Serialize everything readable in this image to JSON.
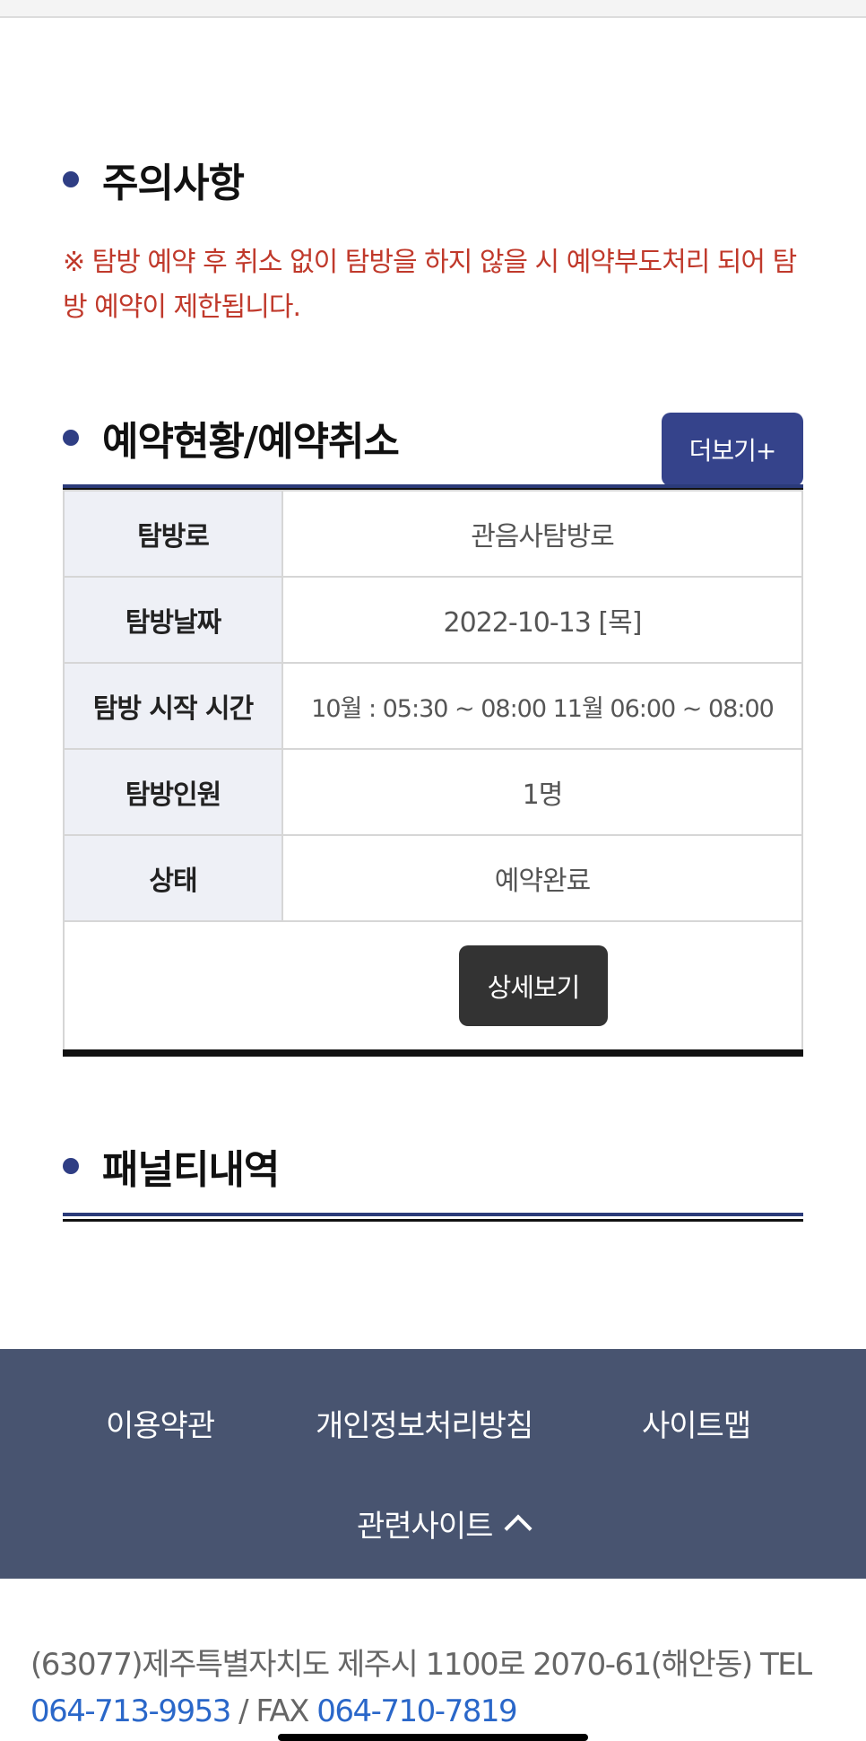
{
  "notice": {
    "title": "주의사항",
    "text": "※ 탐방 예약 후 취소 없이 탐방을 하지 않을 시 예약부도처리 되어 탐방 예약이 제한됩니다."
  },
  "reservation": {
    "title": "예약현황/예약취소",
    "more_label": "더보기+",
    "rows": [
      {
        "label": "탐방로",
        "value": "관음사탐방로"
      },
      {
        "label": "탐방날짜",
        "value": "2022-10-13 [목]"
      },
      {
        "label": "탐방 시작 시간",
        "value": "10월 : 05:30 ~ 08:00 11월 06:00 ~ 08:00"
      },
      {
        "label": "탐방인원",
        "value": "1명"
      },
      {
        "label": "상태",
        "value": "예약완료"
      }
    ],
    "detail_label": "상세보기"
  },
  "penalty": {
    "title": "패널티내역"
  },
  "footer": {
    "links": [
      "이용약관",
      "개인정보처리방침",
      "사이트맵"
    ],
    "related_label": "관련사이트",
    "address": "(63077)제주특별자치도 제주시 1100로 2070-61(해안동) TEL",
    "tel": "064-713-9953",
    "fax_label": "/ FAX",
    "fax": "064-710-7819"
  },
  "colors": {
    "accent": "#2f3e84",
    "notice": "#c0392b",
    "footer_bg": "#485470",
    "link": "#2a67c9"
  }
}
